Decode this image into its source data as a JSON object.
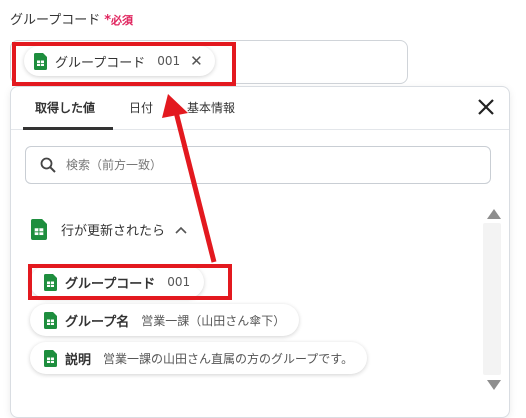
{
  "field": {
    "label": "グループコード",
    "required_star": "*",
    "required_text": "必須",
    "selected_chip": {
      "name": "グループコード",
      "value": "001"
    },
    "close_glyph": "✕"
  },
  "popover": {
    "tabs": [
      {
        "label": "取得した値",
        "active": true
      },
      {
        "label": "日付",
        "active": false
      },
      {
        "label": "基本情報",
        "active": false
      }
    ],
    "search": {
      "placeholder": "検索（前方一致）"
    },
    "section": {
      "title": "行が更新されたら",
      "expanded": true
    },
    "items": [
      {
        "name": "グループコード",
        "value": "001"
      },
      {
        "name": "グループ名",
        "value": "営業一課（山田さん傘下）"
      },
      {
        "name": "説明",
        "value": "営業一課の山田さん直属の方のグループです。"
      }
    ]
  },
  "colors": {
    "highlight": "#e3191f",
    "sheets_green": "#1e8e3e",
    "required": "#e0245e"
  },
  "icons": {
    "sheet": "google-sheets-icon",
    "search": "search-icon",
    "close": "close-icon",
    "chevron": "chevron-up-icon"
  }
}
